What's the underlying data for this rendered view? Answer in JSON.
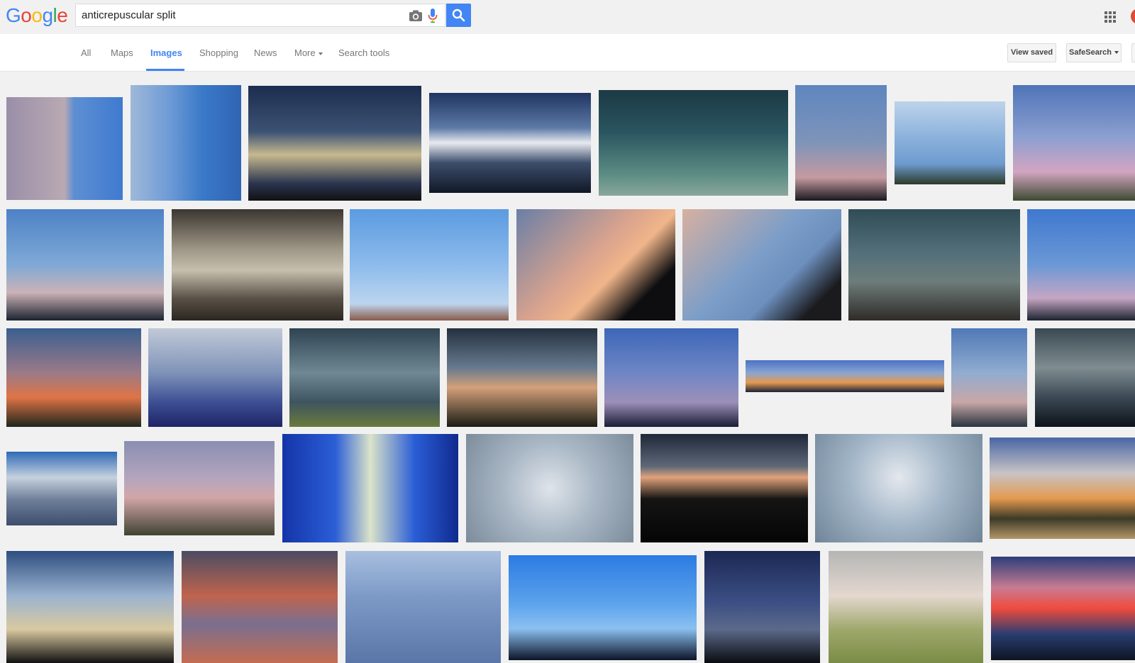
{
  "search": {
    "query": "anticrepuscular split"
  },
  "nav": {
    "tabs": [
      "All",
      "Maps",
      "Images",
      "Shopping",
      "News",
      "More",
      "Search tools"
    ],
    "active": "Images",
    "view_saved": "View saved",
    "safesearch": "SafeSearch"
  },
  "icons": [
    "camera-icon",
    "microphone-icon",
    "search-icon",
    "apps-grid-icon"
  ],
  "colors": {
    "accent": "#4285f4",
    "background": "#f1f1f1"
  }
}
